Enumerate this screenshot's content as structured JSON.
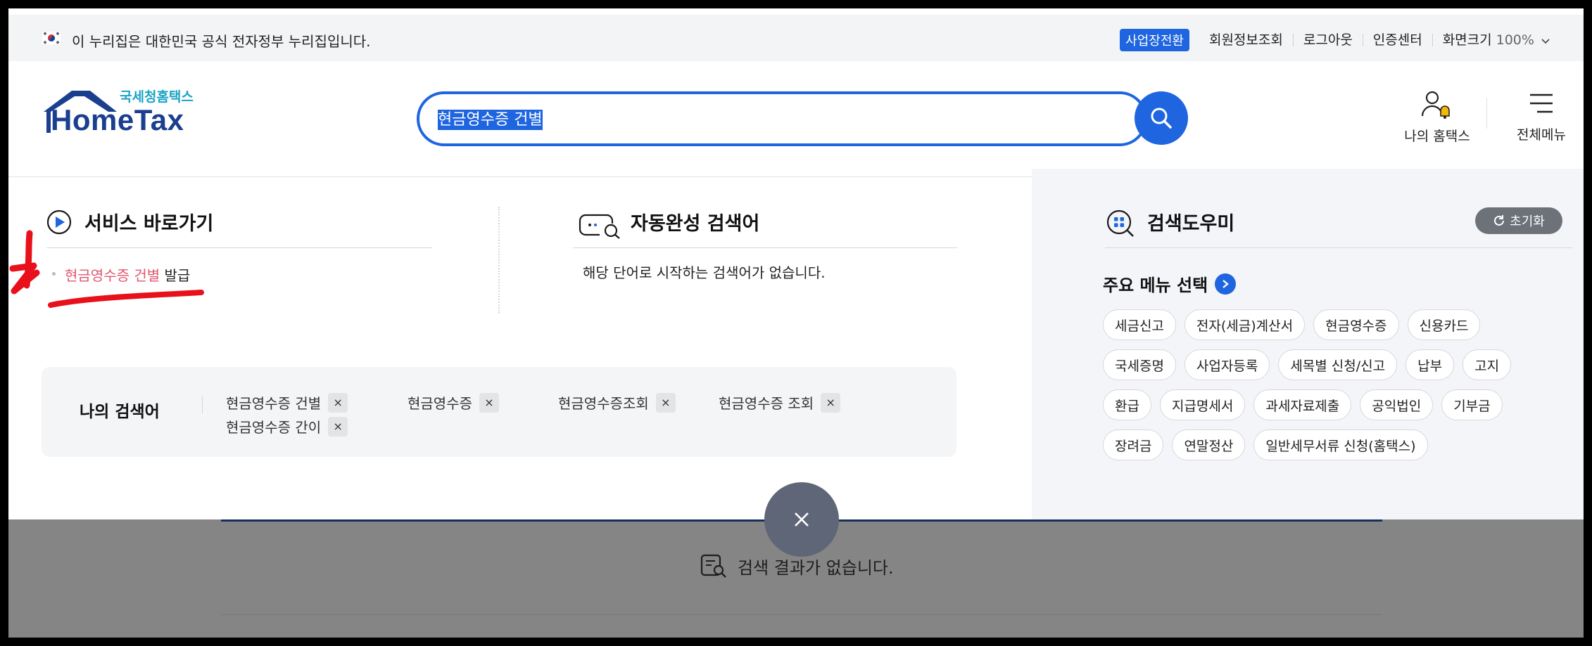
{
  "govbar": {
    "notice": "이 누리집은 대한민국 공식 전자정부 누리집입니다.",
    "biz_switch": "사업장전환",
    "links": [
      "회원정보조회",
      "로그아웃",
      "인증센터"
    ],
    "zoom_label": "화면크기",
    "zoom_value": "100%"
  },
  "header": {
    "logo_sub": "국세청홈택스",
    "logo_main": "HomeTax",
    "search_value": "현금영수증 건별",
    "my_hometax": "나의 홈택스",
    "all_menu": "전체메뉴"
  },
  "service": {
    "title": "서비스 바로가기",
    "link_highlight": "현금영수증 건별",
    "link_rest": " 발급"
  },
  "autocomplete": {
    "title": "자동완성 검색어",
    "empty_msg": "해당 단어로 시작하는 검색어가 없습니다."
  },
  "my_search": {
    "title": "나의 검색어",
    "keywords": [
      "현금영수증 건별",
      "현금영수증",
      "현금영수증조회",
      "현금영수증 조회",
      "현금영수증 간이"
    ],
    "remove_glyph": "×"
  },
  "helper": {
    "title": "검색도우미",
    "reset": "초기화",
    "main_menu": "주요 메뉴 선택",
    "chip_rows": [
      [
        "세금신고",
        "전자(세금)계산서",
        "현금영수증",
        "신용카드"
      ],
      [
        "국세증명",
        "사업자등록",
        "세목별 신청/신고",
        "납부",
        "고지"
      ],
      [
        "환급",
        "지급명세서",
        "과세자료제출",
        "공익법인",
        "기부금"
      ],
      [
        "장려금",
        "연말정산",
        "일반세무서류 신청(홈택스)"
      ]
    ]
  },
  "overlay": {
    "no_result": "검색 결과가 없습니다."
  },
  "colors": {
    "accent": "#1f65e0",
    "highlight_red": "#e0566e",
    "annotation_red": "#e8101a"
  }
}
